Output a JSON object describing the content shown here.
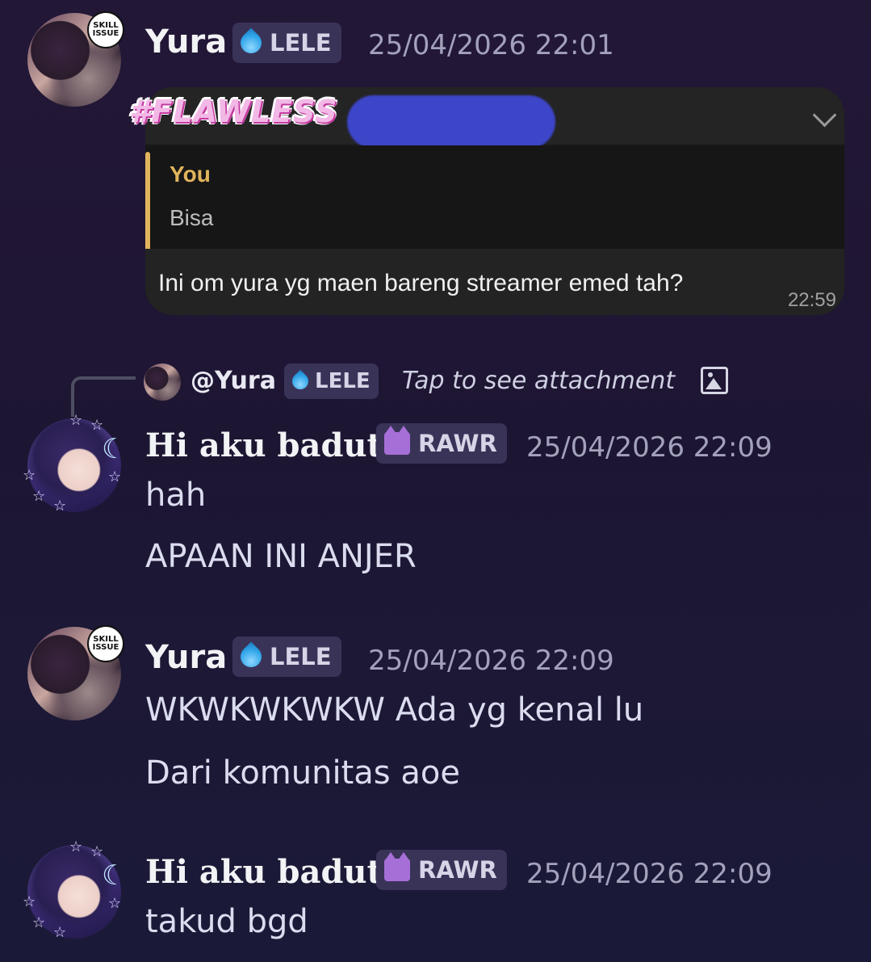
{
  "screenshot_post": {
    "author": "Yura",
    "badge": "LELE",
    "timestamp": "25/04/2026 22:01",
    "avatar_bubble": "SKILL ISSUE",
    "embedded_screenshot": {
      "sticker_text": "#FLAWLESS",
      "quoted_name": "You",
      "quoted_text": "Bisa",
      "message": "Ini om yura yg maen bareng streamer emed tah?",
      "time": "22:59"
    }
  },
  "reply_preview": {
    "mention": "@Yura",
    "badge": "LELE",
    "text": "Tap to see attachment"
  },
  "messages": [
    {
      "author": "Hi aku badut",
      "badge": "RAWR",
      "timestamp": "25/04/2026 22:09",
      "lines": [
        "hah",
        "APAAN INI ANJER"
      ]
    },
    {
      "author": "Yura",
      "badge": "LELE",
      "timestamp": "25/04/2026 22:09",
      "avatar_bubble": "SKILL ISSUE",
      "lines": [
        "WKWKWKWKW Ada yg kenal lu",
        "Dari komunitas aoe"
      ]
    },
    {
      "author": "Hi aku badut",
      "badge": "RAWR",
      "timestamp": "25/04/2026 22:09",
      "lines": [
        "takud bgd"
      ]
    }
  ],
  "colors": {
    "background": "#1f1735",
    "badge_bg": "#3a3358",
    "quote_accent": "#e2b45c",
    "blur_pill": "#3d45c9"
  }
}
